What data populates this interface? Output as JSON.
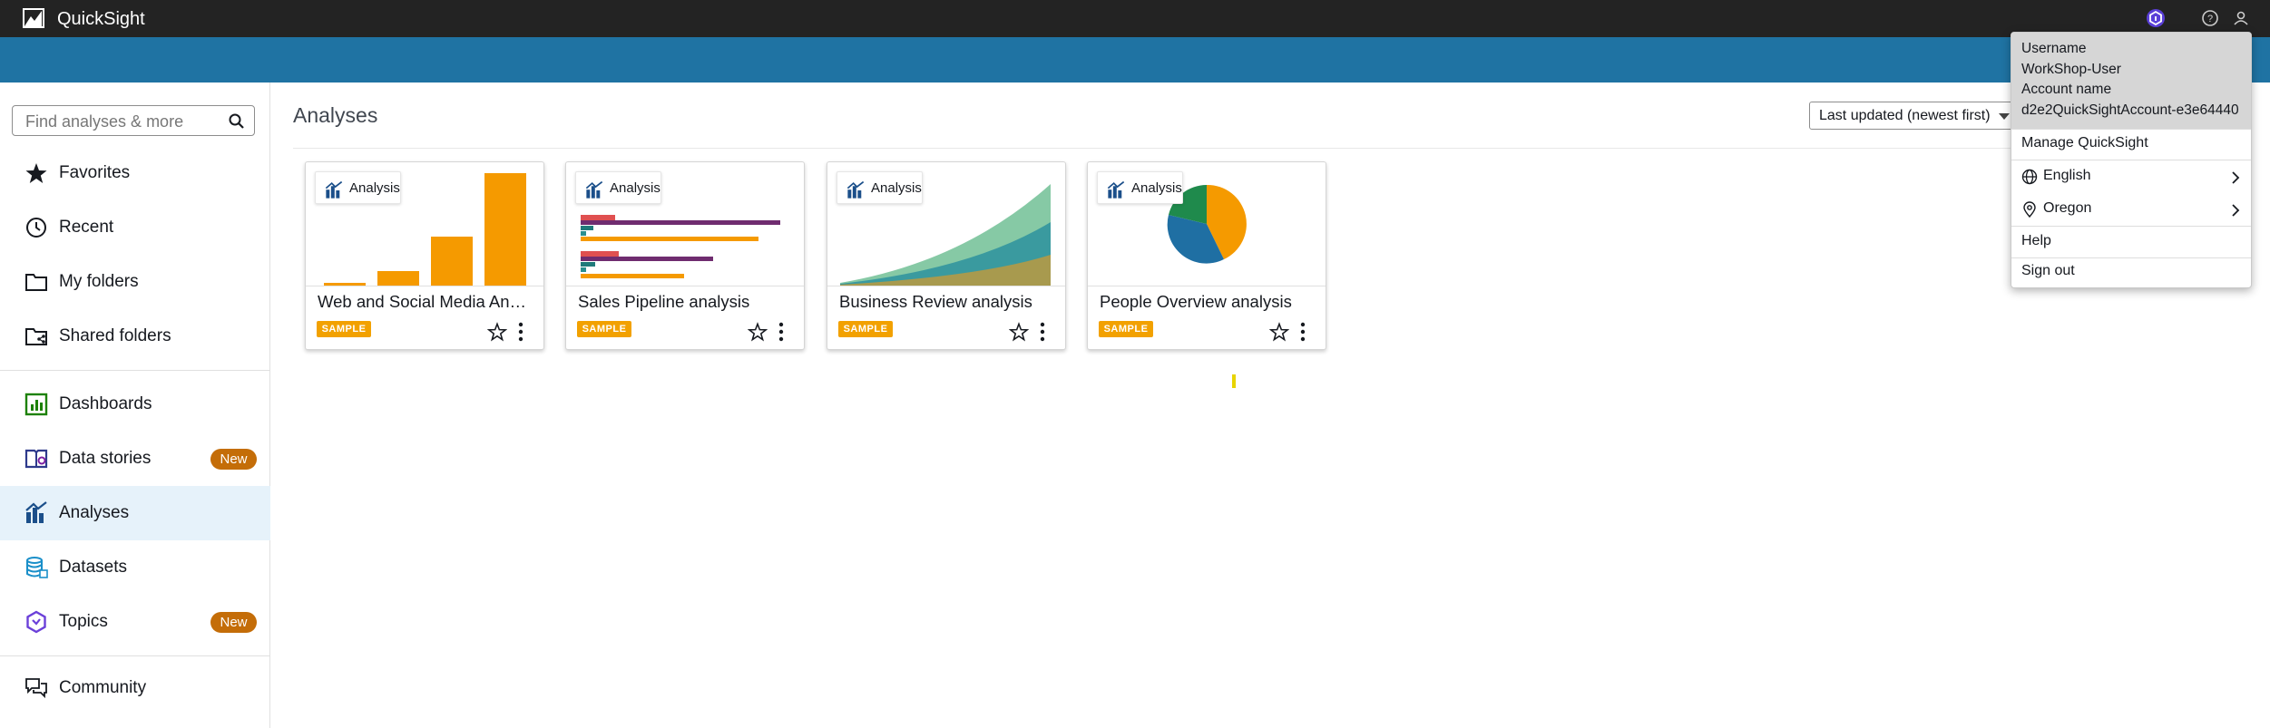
{
  "app": {
    "name": "QuickSight"
  },
  "search": {
    "placeholder": "Find analyses & more"
  },
  "sidebar": {
    "items": [
      {
        "label": "Favorites"
      },
      {
        "label": "Recent"
      },
      {
        "label": "My folders"
      },
      {
        "label": "Shared folders"
      },
      {
        "label": "Dashboards"
      },
      {
        "label": "Data stories",
        "badge": "New"
      },
      {
        "label": "Analyses"
      },
      {
        "label": "Datasets"
      },
      {
        "label": "Topics",
        "badge": "New"
      },
      {
        "label": "Community"
      }
    ]
  },
  "main": {
    "title": "Analyses",
    "sort": {
      "selected": "Last updated (newest first)"
    },
    "cards": [
      {
        "type": "Analysis",
        "title": "Web and Social Media Anal...",
        "tag": "SAMPLE"
      },
      {
        "type": "Analysis",
        "title": "Sales Pipeline analysis",
        "tag": "SAMPLE"
      },
      {
        "type": "Analysis",
        "title": "Business Review analysis",
        "tag": "SAMPLE"
      },
      {
        "type": "Analysis",
        "title": "People Overview analysis",
        "tag": "SAMPLE"
      }
    ]
  },
  "account_menu": {
    "username_label": "Username",
    "username": "WorkShop-User",
    "account_label": "Account name",
    "account": "d2e2QuickSightAccount-e3e64440",
    "manage": "Manage QuickSight",
    "language": "English",
    "region": "Oregon",
    "help": "Help",
    "signout": "Sign out"
  },
  "colors": {
    "topbar": "#232323",
    "band": "#1f73a3",
    "accent_orange": "#f2a100",
    "badge_new": "#c46d08",
    "active_nav": "#e6f2fa"
  }
}
